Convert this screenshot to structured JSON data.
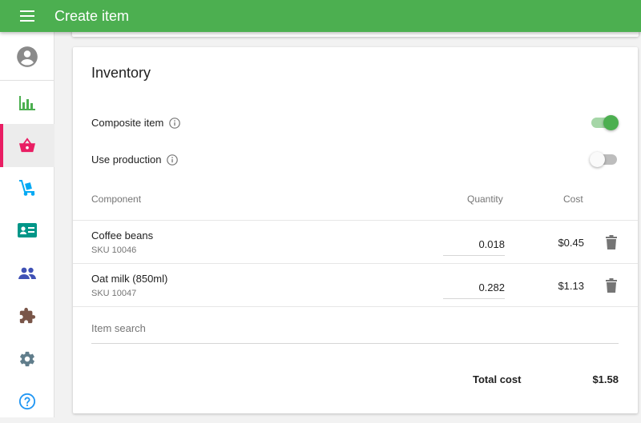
{
  "app": {
    "title": "Create item",
    "accent": "#4caf50",
    "active_indicator": "#e91e63"
  },
  "sidebar": {
    "items": [
      {
        "name": "account",
        "icon": "account-circle-icon",
        "color": "#757575"
      },
      {
        "name": "reports",
        "icon": "bar-chart-icon",
        "color": "#4caf50"
      },
      {
        "name": "items",
        "icon": "basket-icon",
        "color": "#e91e63",
        "active": true
      },
      {
        "name": "inventory",
        "icon": "dolly-icon",
        "color": "#03a9f4"
      },
      {
        "name": "customers",
        "icon": "id-card-icon",
        "color": "#009688"
      },
      {
        "name": "employees",
        "icon": "people-icon",
        "color": "#3f51b5"
      },
      {
        "name": "integrations",
        "icon": "puzzle-icon",
        "color": "#795548"
      },
      {
        "name": "settings",
        "icon": "gear-icon",
        "color": "#607d8b"
      },
      {
        "name": "help",
        "icon": "help-circle-icon",
        "color": "#2196f3"
      }
    ]
  },
  "inventory": {
    "title": "Inventory",
    "composite_label": "Composite item",
    "composite_on": true,
    "production_label": "Use production",
    "production_on": false,
    "columns": {
      "component": "Component",
      "quantity": "Quantity",
      "cost": "Cost"
    },
    "components": [
      {
        "name": "Coffee beans",
        "sku": "SKU 10046",
        "quantity": "0.018",
        "cost": "$0.45"
      },
      {
        "name": "Oat milk (850ml)",
        "sku": "SKU 10047",
        "quantity": "0.282",
        "cost": "$1.13"
      }
    ],
    "search_placeholder": "Item search",
    "total_label": "Total cost",
    "total_value": "$1.58"
  }
}
